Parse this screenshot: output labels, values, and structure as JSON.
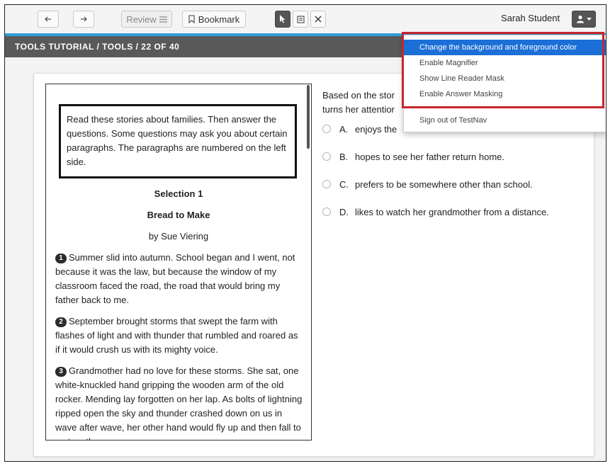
{
  "toolbar": {
    "back_icon": "arrow-left-icon",
    "forward_icon": "arrow-right-icon",
    "review_label": "Review",
    "review_icon": "list-icon",
    "bookmark_label": "Bookmark",
    "bookmark_icon": "bookmark-icon",
    "pointer_icon": "cursor-icon",
    "notes_icon": "notes-icon",
    "close_icon": "close-icon",
    "user_name": "Sarah Student",
    "user_icon": "user-icon",
    "accent_color": "#2f9ed8"
  },
  "breadcrumb": "TOOLS TUTORIAL / TOOLS / 22 OF 40",
  "user_menu": {
    "items": [
      "Change the background and foreground color",
      "Enable Magnifier",
      "Show Line Reader Mask",
      "Enable Answer Masking"
    ],
    "signout": "Sign out of TestNav",
    "selected_color": "#1c6fd6",
    "highlight_color": "#c8242c"
  },
  "passage": {
    "intro": "Read these stories about families. Then answer the questions. Some questions may ask you about certain paragraphs. The paragraphs are numbered on the left side.",
    "selection": "Selection 1",
    "title": "Bread to Make",
    "author": "by Sue Viering",
    "paragraphs": [
      {
        "num": "1",
        "text": "Summer slid into autumn. School began and I went, not because it was the law, but because the window of my classroom faced the road, the road that would bring my father back to me."
      },
      {
        "num": "2",
        "text": "September brought storms that swept the farm with flashes of light and with thunder that rumbled and roared as if it would crush us with its mighty voice."
      },
      {
        "num": "3",
        "text": "Grandmother had no love for these storms. She sat, one white-knuckled hand gripping the wooden arm of the old rocker. Mending lay forgotten on her lap. As bolts of lightning ripped open the sky and thunder crashed down on us in wave after wave, her other hand would fly up and then fall to rest on the"
      }
    ]
  },
  "question": {
    "line1": "Based on the stor",
    "line2": "turns her attentior",
    "options": [
      {
        "letter": "A.",
        "text": "enjoys the"
      },
      {
        "letter": "B.",
        "text": "hopes to see her father return home."
      },
      {
        "letter": "C.",
        "text": "prefers to be somewhere other than school."
      },
      {
        "letter": "D.",
        "text": "likes to watch her grandmother from a distance."
      }
    ]
  }
}
